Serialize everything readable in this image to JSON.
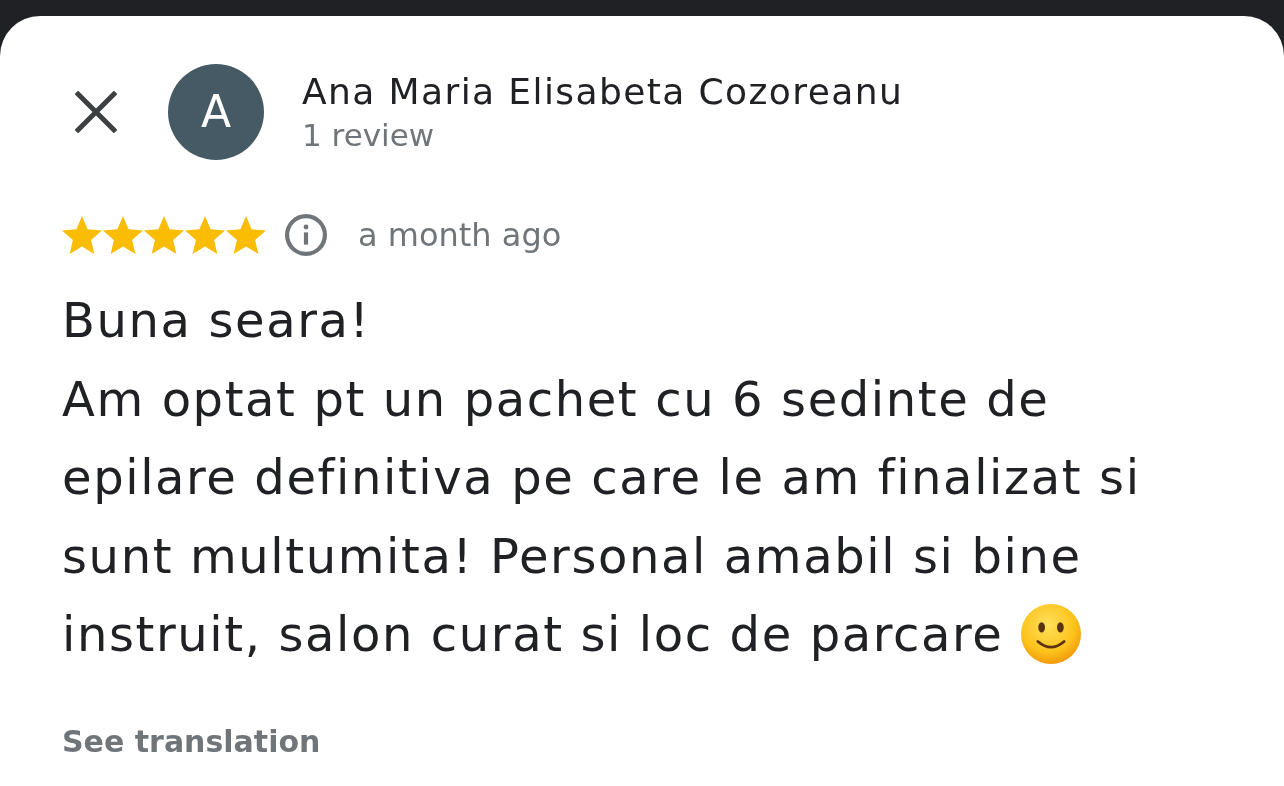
{
  "reviewer": {
    "avatar_letter": "A",
    "name": "Ana Maria Elisabeta Cozoreanu",
    "review_count": "1 review"
  },
  "review": {
    "stars": 5,
    "time": "a month ago",
    "text_lines": [
      "Buna seara!",
      "Am optat pt un pachet cu 6 sedinte de",
      "epilare definitiva pe care le am finalizat si",
      "sunt multumita! Personal amabil si bine",
      "instruit, salon curat si loc de parcare"
    ],
    "translate_link": "See translation"
  }
}
